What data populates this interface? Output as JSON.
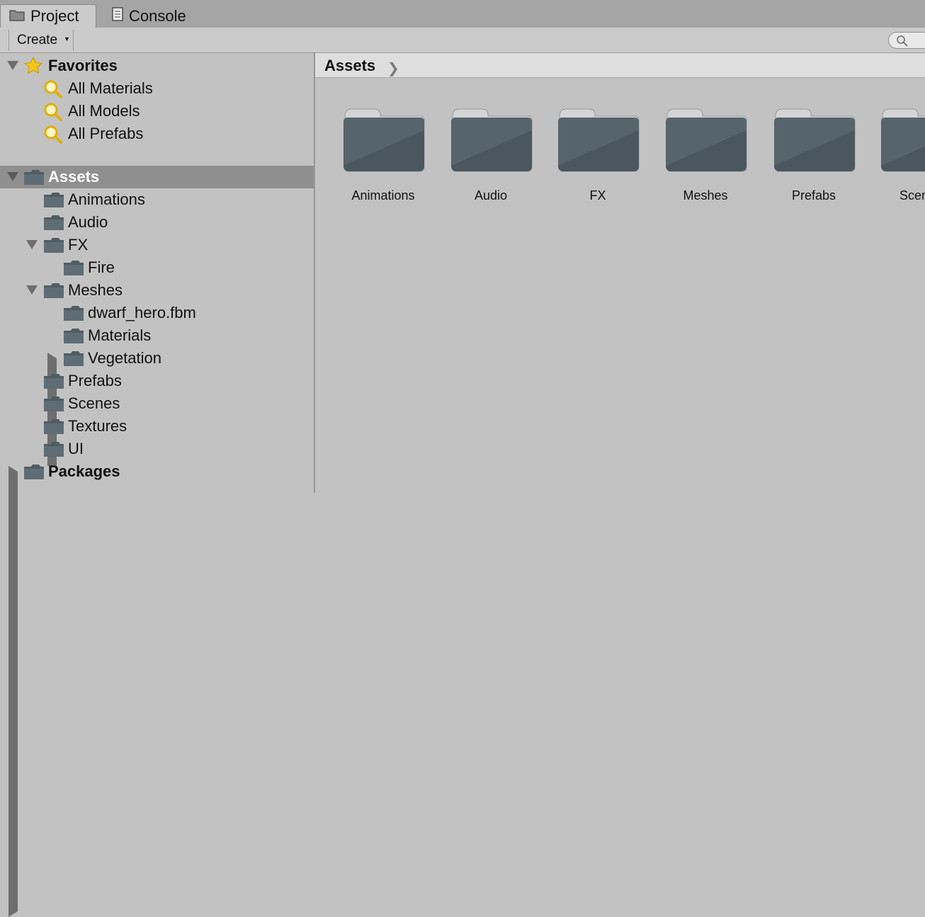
{
  "tabs": [
    {
      "label": "Project",
      "icon": "folder-icon",
      "active": true
    },
    {
      "label": "Console",
      "icon": "console-icon",
      "active": false
    }
  ],
  "toolbar": {
    "create_label": "Create"
  },
  "favorites": {
    "label": "Favorites",
    "items": [
      "All Materials",
      "All Models",
      "All Prefabs"
    ]
  },
  "tree": {
    "assets_label": "Assets",
    "items": [
      {
        "label": "Animations"
      },
      {
        "label": "Audio"
      },
      {
        "label": "FX"
      },
      {
        "label": "Fire"
      },
      {
        "label": "Meshes"
      },
      {
        "label": "dwarf_hero.fbm"
      },
      {
        "label": "Materials"
      },
      {
        "label": "Vegetation"
      },
      {
        "label": "Prefabs"
      },
      {
        "label": "Scenes"
      },
      {
        "label": "Textures"
      },
      {
        "label": "UI"
      }
    ],
    "packages_label": "Packages"
  },
  "breadcrumb": {
    "label": "Assets"
  },
  "grid": {
    "items": [
      "Animations",
      "Audio",
      "FX",
      "Meshes",
      "Prefabs",
      "Scenes"
    ]
  },
  "colors": {
    "folder": "#5a6870",
    "selection": "#8f8f8f",
    "background": "#c2c2c2"
  }
}
